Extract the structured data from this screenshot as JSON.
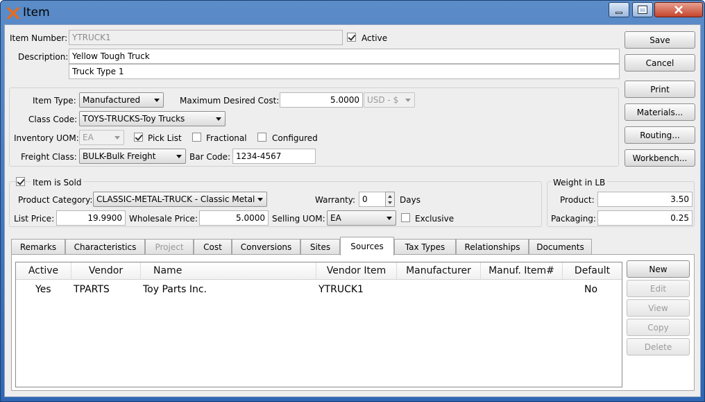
{
  "window": {
    "title": "Item"
  },
  "header": {
    "item_number_label": "Item Number:",
    "item_number": "YTRUCK1",
    "active_label": "Active",
    "active": true,
    "description_label": "Description:",
    "description1": "Yellow Tough Truck",
    "description2": "Truck Type 1"
  },
  "actions": {
    "save": "Save",
    "cancel": "Cancel",
    "print": "Print",
    "materials": "Materials...",
    "routing": "Routing...",
    "workbench": "Workbench..."
  },
  "details": {
    "item_type_label": "Item Type:",
    "item_type": "Manufactured",
    "max_cost_label": "Maximum Desired Cost:",
    "max_cost": "5.0000",
    "currency": "USD - $",
    "class_code_label": "Class Code:",
    "class_code": "TOYS-TRUCKS-Toy Trucks",
    "inventory_uom_label": "Inventory UOM:",
    "inventory_uom": "EA",
    "pick_list_label": "Pick List",
    "pick_list": true,
    "fractional_label": "Fractional",
    "fractional": false,
    "configured_label": "Configured",
    "configured": false,
    "freight_class_label": "Freight Class:",
    "freight_class": "BULK-Bulk Freight",
    "bar_code_label": "Bar Code:",
    "bar_code": "1234-4567"
  },
  "sold": {
    "item_is_sold_label": "Item is Sold",
    "item_is_sold": true,
    "product_category_label": "Product Category:",
    "product_category": "CLASSIC-METAL-TRUCK - Classic Metal",
    "warranty_label": "Warranty:",
    "warranty": "0",
    "days_label": "Days",
    "list_price_label": "List Price:",
    "list_price": "19.9900",
    "wholesale_price_label": "Wholesale Price:",
    "wholesale_price": "5.0000",
    "selling_uom_label": "Selling UOM:",
    "selling_uom": "EA",
    "exclusive_label": "Exclusive",
    "exclusive": false
  },
  "weight": {
    "title": "Weight in LB",
    "product_label": "Product:",
    "product": "3.50",
    "packaging_label": "Packaging:",
    "packaging": "0.25"
  },
  "tabs": [
    {
      "label": "Remarks"
    },
    {
      "label": "Characteristics"
    },
    {
      "label": "Project"
    },
    {
      "label": "Cost"
    },
    {
      "label": "Conversions"
    },
    {
      "label": "Sites"
    },
    {
      "label": "Sources"
    },
    {
      "label": "Tax Types"
    },
    {
      "label": "Relationships"
    },
    {
      "label": "Documents"
    }
  ],
  "active_tab": "Sources",
  "sources": {
    "columns": [
      "Active",
      "Vendor",
      "Name",
      "Vendor Item",
      "Manufacturer",
      "Manuf. Item#",
      "Default"
    ],
    "rows": [
      [
        "Yes",
        "TPARTS",
        "Toy Parts Inc.",
        "YTRUCK1",
        "",
        "",
        "No"
      ]
    ],
    "buttons": {
      "new": "New",
      "edit": "Edit",
      "view": "View",
      "copy": "Copy",
      "delete": "Delete"
    }
  }
}
